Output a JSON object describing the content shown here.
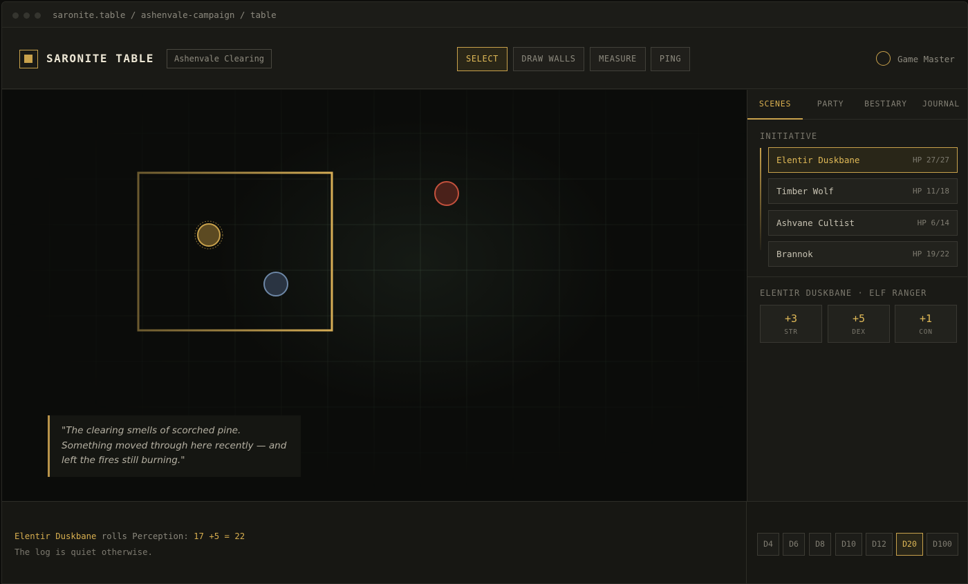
{
  "window": {
    "path": "saronite.table / ashenvale-campaign / table"
  },
  "header": {
    "brand": "SARONITE TABLE",
    "scene": "Ashenvale Clearing",
    "tools": [
      "SELECT",
      "DRAW WALLS",
      "MEASURE",
      "PING"
    ],
    "active_tool": "SELECT",
    "role": "Game Master"
  },
  "map": {
    "narration": "\"The clearing smells of scorched pine. Something moved through here recently — and left the fires still burning.\"",
    "token_colors": {
      "hero": "#c9a24c",
      "ally": "#6d87a6",
      "enemy": "#c4513d"
    }
  },
  "sidebar": {
    "tabs": [
      "SCENES",
      "PARTY",
      "BESTIARY",
      "JOURNAL"
    ],
    "active_tab": "SCENES",
    "initiative_label": "INITIATIVE",
    "initiative": [
      {
        "name": "Elentir Duskbane",
        "hp": "HP 27/27",
        "active": true
      },
      {
        "name": "Timber Wolf",
        "hp": "HP 11/18",
        "active": false
      },
      {
        "name": "Ashvane Cultist",
        "hp": "HP 6/14",
        "active": false
      },
      {
        "name": "Brannok",
        "hp": "HP 19/22",
        "active": false
      }
    ],
    "character_label": "ELENTIR DUSKBANE · ELF RANGER",
    "stats": [
      {
        "value": "+3",
        "key": "STR"
      },
      {
        "value": "+5",
        "key": "DEX"
      },
      {
        "value": "+1",
        "key": "CON"
      }
    ]
  },
  "log": {
    "actor": "Elentir Duskbane",
    "verb": " rolls Perception: ",
    "result": "17 +5 = 22",
    "line2": "The log is quiet otherwise."
  },
  "dice": {
    "items": [
      "D4",
      "D6",
      "D8",
      "D10",
      "D12",
      "D20",
      "D100"
    ],
    "active": "D20"
  },
  "colors": {
    "accent": "#c9a24c",
    "background": "#171713"
  }
}
